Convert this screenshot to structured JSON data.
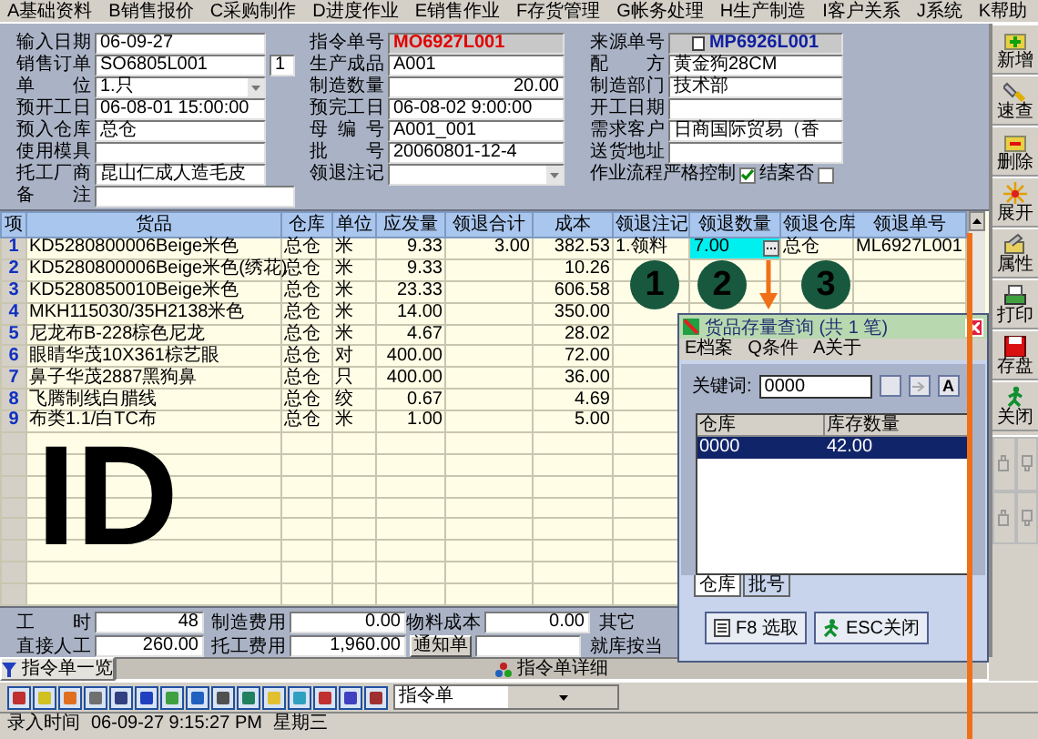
{
  "menu": [
    {
      "label": "A基础资料"
    },
    {
      "label": "B销售报价"
    },
    {
      "label": "C采购制作"
    },
    {
      "label": "D进度作业"
    },
    {
      "label": "E销售作业"
    },
    {
      "label": "F存货管理"
    },
    {
      "label": "G帐务处理"
    },
    {
      "label": "H生产制造"
    },
    {
      "label": "I客户关系"
    },
    {
      "label": "J系统"
    },
    {
      "label": "K帮助"
    }
  ],
  "form": {
    "rows": [
      [
        {
          "label": "输入日期",
          "kind": "text",
          "value": "06-09-27"
        },
        {
          "label": "指令单号",
          "kind": "code",
          "value": "MO6927L001"
        },
        {
          "label": "来源单号",
          "kind": "source",
          "value": "MP6926L001"
        }
      ],
      [
        {
          "label": "销售订单",
          "kind": "text",
          "value": "SO6805L001",
          "extra": "1"
        },
        {
          "label": "生产成品",
          "kind": "text",
          "value": "A001"
        },
        {
          "label": "配方",
          "kind": "text",
          "value": "黄金狗28CM"
        }
      ],
      [
        {
          "label": "单位",
          "kind": "select",
          "value": "1.只"
        },
        {
          "label": "制造数量",
          "kind": "number",
          "value": "20.00"
        },
        {
          "label": "制造部门",
          "kind": "text",
          "value": "技术部"
        }
      ],
      [
        {
          "label": "预开工日",
          "kind": "text",
          "value": "06-08-01 15:00:00"
        },
        {
          "label": "预完工日",
          "kind": "text",
          "value": "06-08-02 9:00:00"
        },
        {
          "label": "开工日期",
          "kind": "text"
        }
      ],
      [
        {
          "label": "预入仓库",
          "kind": "text",
          "value": "总仓"
        },
        {
          "label": "母编号",
          "kind": "text",
          "value": "A001_001"
        },
        {
          "label": "需求客户",
          "kind": "text",
          "value": "日商国际贸易（香"
        }
      ],
      [
        {
          "label": "使用模具",
          "kind": "text"
        },
        {
          "label": "批号",
          "kind": "text",
          "value": "20060801-12-4"
        },
        {
          "label": "送货地址",
          "kind": "text"
        }
      ],
      [
        {
          "label": "托工厂商",
          "kind": "text",
          "value": "昆山仁成人造毛皮"
        },
        {
          "label": "领退注记",
          "kind": "select"
        },
        {
          "kind": "checks",
          "items": [
            {
              "label": "作业流程严格控制",
              "checked": true
            },
            {
              "label": "结案否",
              "checked": false
            }
          ]
        }
      ],
      [
        {
          "label": "备注",
          "kind": "text"
        }
      ]
    ]
  },
  "grid": {
    "columns": [
      "项",
      "货品",
      "仓库",
      "单位",
      "应发量",
      "领退合计",
      "成本",
      "领退注记",
      "领退数量",
      "领退仓库",
      "领退单号"
    ],
    "rows": [
      {
        "editing": true,
        "cells": [
          "1",
          "KD5280800006Beige米色",
          "总仓",
          "米",
          "9.33",
          "3.00",
          "382.53",
          "1.领料",
          "7.00",
          "总仓",
          "ML6927L001"
        ]
      },
      {
        "editing": false,
        "cells": [
          "2",
          "KD5280800006Beige米色(绣花)",
          "总仓",
          "米",
          "9.33",
          null,
          "10.26",
          null,
          null,
          null,
          null
        ]
      },
      {
        "editing": false,
        "cells": [
          "3",
          "KD5280850010Beige米色",
          "总仓",
          "米",
          "23.33",
          null,
          "606.58",
          null,
          null,
          null,
          null
        ]
      },
      {
        "editing": false,
        "cells": [
          "4",
          "MKH115030/35H2138米色",
          "总仓",
          "米",
          "14.00",
          null,
          "350.00",
          null,
          null,
          null,
          null
        ]
      },
      {
        "editing": false,
        "cells": [
          "5",
          "尼龙布B-228棕色尼龙",
          "总仓",
          "米",
          "4.67",
          null,
          "28.02",
          null,
          null,
          null,
          null
        ]
      },
      {
        "editing": false,
        "cells": [
          "6",
          "眼睛华茂10X361棕艺眼",
          "总仓",
          "对",
          "400.00",
          null,
          "72.00",
          null,
          null,
          null,
          null
        ]
      },
      {
        "editing": false,
        "cells": [
          "7",
          "鼻子华茂2887黑狗鼻",
          "总仓",
          "只",
          "400.00",
          null,
          "36.00",
          null,
          null,
          null,
          null
        ]
      },
      {
        "editing": false,
        "cells": [
          "8",
          "飞腾制线白腊线",
          "总仓",
          "绞",
          "0.67",
          null,
          "4.69",
          null,
          null,
          null,
          null
        ]
      },
      {
        "editing": false,
        "cells": [
          "9",
          "布类1.1/白TC布",
          "总仓",
          "米",
          "1.00",
          null,
          "5.00",
          null,
          null,
          null,
          null
        ]
      }
    ]
  },
  "totals": {
    "rows": [
      [
        {
          "kind": "field",
          "label": "工时",
          "value": "48"
        },
        {
          "kind": "field",
          "label": "制造费用",
          "value": "0.00"
        },
        {
          "kind": "field",
          "label": "物料成本",
          "value": "0.00"
        },
        {
          "kind": "label",
          "label": "其它"
        }
      ],
      [
        {
          "kind": "field",
          "label": "直接人工",
          "value": "260.00"
        },
        {
          "kind": "field",
          "label": "托工费用",
          "value": "1,960.00"
        },
        {
          "kind": "button",
          "label": "通知单"
        },
        {
          "kind": "box"
        },
        {
          "kind": "label",
          "label": "就库按当"
        }
      ]
    ]
  },
  "sidebar": [
    {
      "label": "新增"
    },
    {
      "label": "速查"
    },
    {
      "label": "删除"
    },
    {
      "label": "展开"
    },
    {
      "label": "属性"
    },
    {
      "label": "打印"
    },
    {
      "label": "存盘"
    },
    {
      "label": "关闭"
    }
  ],
  "view_tabs": [
    {
      "label": "指令单一览",
      "selected": false
    },
    {
      "label": "指令单详细",
      "selected": true
    }
  ],
  "tool_strip": {
    "combo": "指令单"
  },
  "status_bar": [
    {
      "text": "录入时间"
    },
    {
      "text": "06-09-27 9:15:27 PM"
    },
    {
      "text": "星期三"
    }
  ],
  "dialog": {
    "title": "货品存量查询 (共 1 笔)",
    "menu": [
      "E档案",
      "Q条件",
      "A关于"
    ],
    "keyword_label": "关键词:",
    "keyword": "0000",
    "letter_button": "A",
    "columns": [
      "仓库",
      "库存数量"
    ],
    "rows": [
      {
        "cells": [
          "0000",
          "42.00"
        ],
        "selected": true
      }
    ],
    "tabs": [
      {
        "label": "仓库",
        "selected": true
      },
      {
        "label": "批号",
        "selected": false
      }
    ],
    "buttons": [
      {
        "label": "F8 选取"
      },
      {
        "label": "ESC关闭"
      }
    ]
  },
  "annotations": {
    "label": "ID",
    "markers": [
      "1",
      "2",
      "3"
    ]
  }
}
